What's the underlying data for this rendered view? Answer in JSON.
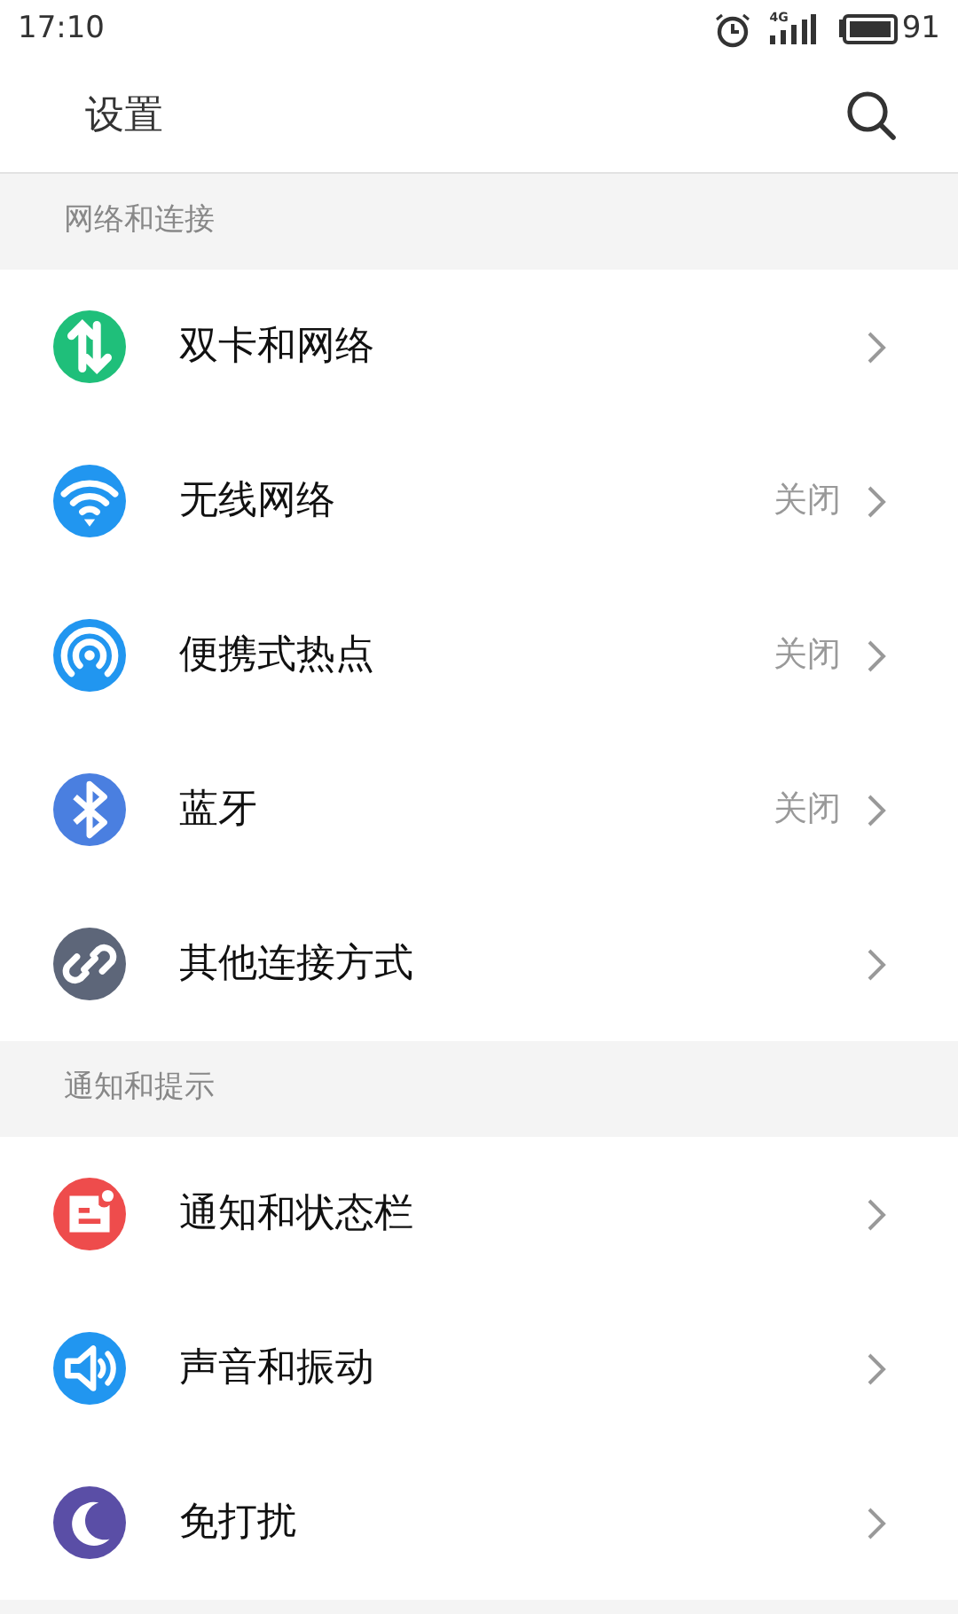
{
  "status_bar": {
    "time": "17:10",
    "network": "4G",
    "battery": "91"
  },
  "header": {
    "title": "设置"
  },
  "sections": [
    {
      "title": "网络和连接",
      "items": [
        {
          "label": "双卡和网络",
          "color": "#1fbf7a"
        },
        {
          "label": "无线网络",
          "color": "#2196f0",
          "value": "关闭"
        },
        {
          "label": "便携式热点",
          "color": "#2196f0",
          "value": "关闭"
        },
        {
          "label": "蓝牙",
          "color": "#4a7fe0",
          "value": "关闭"
        },
        {
          "label": "其他连接方式",
          "color": "#5d6679"
        }
      ]
    },
    {
      "title": "通知和提示",
      "items": [
        {
          "label": "通知和状态栏",
          "color": "#ee4c4c"
        },
        {
          "label": "声音和振动",
          "color": "#2196f0"
        },
        {
          "label": "免打扰",
          "color": "#5a4ea6"
        }
      ]
    }
  ]
}
